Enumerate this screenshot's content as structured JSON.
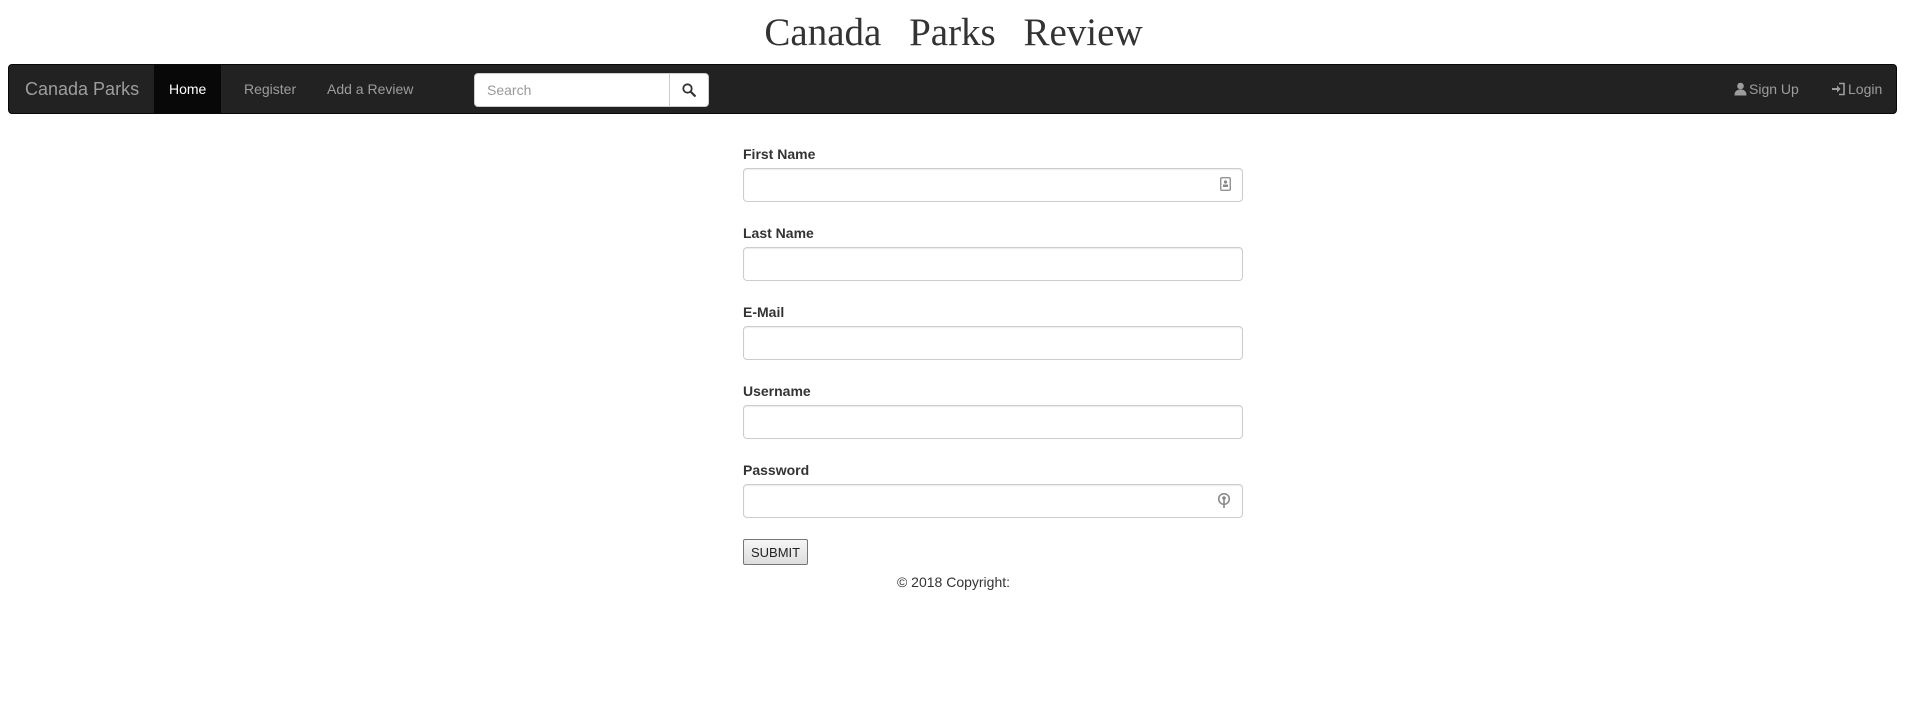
{
  "site_title": "Canada Parks Review",
  "navbar": {
    "brand": "Canada Parks",
    "links": [
      {
        "label": "Home",
        "active": true
      },
      {
        "label": "Register",
        "active": false
      },
      {
        "label": "Add a Review",
        "active": false
      }
    ],
    "search": {
      "placeholder": "Search",
      "value": "",
      "button_icon": "search-icon"
    },
    "right_links": [
      {
        "label": "Sign Up",
        "icon": "user-icon"
      },
      {
        "label": "Login",
        "icon": "log-in-icon"
      }
    ]
  },
  "form": {
    "fields": [
      {
        "label": "First Name",
        "value": "",
        "icon": "contact-card-icon"
      },
      {
        "label": "Last Name",
        "value": ""
      },
      {
        "label": "E-Mail",
        "value": ""
      },
      {
        "label": "Username",
        "value": ""
      },
      {
        "label": "Password",
        "value": "",
        "icon": "key-icon"
      }
    ],
    "submit_label": "SUBMIT"
  },
  "footer": {
    "copyright": "© 2018 Copyright:"
  },
  "colors": {
    "navbar_bg": "#222222",
    "navbar_active_bg": "#080808",
    "navbar_text": "#9d9d9d",
    "text": "#333333"
  }
}
